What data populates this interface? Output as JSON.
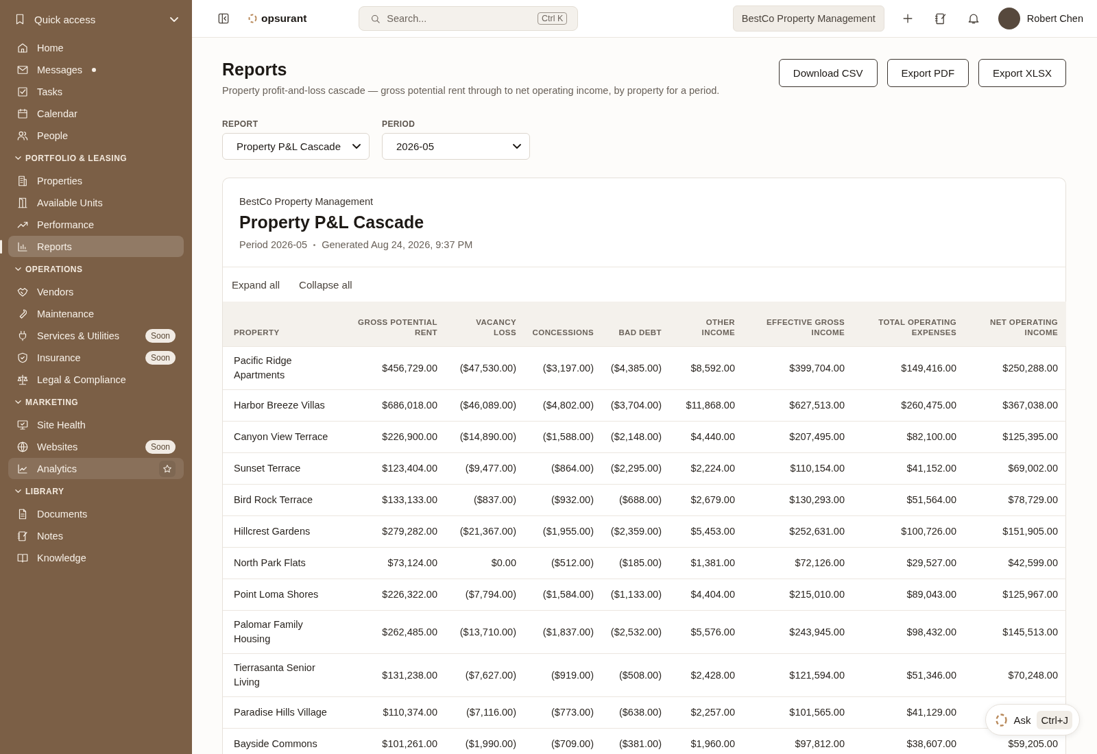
{
  "sidebar": {
    "sections": [
      {
        "kind": "quick",
        "title": "Quick access",
        "expanded": true,
        "items": [
          {
            "label": "Home",
            "selected": false,
            "hovered": false,
            "unread": false
          },
          {
            "label": "Messages",
            "selected": false,
            "hovered": false,
            "unread": true
          },
          {
            "label": "Tasks",
            "selected": false,
            "hovered": false,
            "unread": false
          },
          {
            "label": "Calendar",
            "selected": false,
            "hovered": false,
            "unread": false
          },
          {
            "label": "People",
            "selected": false,
            "hovered": false,
            "unread": false
          }
        ]
      },
      {
        "kind": "group",
        "title": "PORTFOLIO & LEASING",
        "expanded": true,
        "items": [
          {
            "label": "Properties",
            "selected": false,
            "hovered": false,
            "unread": false
          },
          {
            "label": "Available Units",
            "selected": false,
            "hovered": false,
            "unread": false
          },
          {
            "label": "Performance",
            "selected": false,
            "hovered": false,
            "unread": false
          },
          {
            "label": "Reports",
            "selected": true,
            "hovered": false,
            "unread": false
          }
        ]
      },
      {
        "kind": "group",
        "title": "OPERATIONS",
        "expanded": true,
        "items": [
          {
            "label": "Vendors",
            "selected": false,
            "hovered": false,
            "unread": false
          },
          {
            "label": "Maintenance",
            "selected": false,
            "hovered": false,
            "unread": false
          },
          {
            "label": "Services & Utilities",
            "badge": "Soon",
            "selected": false,
            "hovered": false,
            "unread": false
          },
          {
            "label": "Insurance",
            "badge": "Soon",
            "selected": false,
            "hovered": false,
            "unread": false
          },
          {
            "label": "Legal & Compliance",
            "selected": false,
            "hovered": false,
            "unread": false
          }
        ]
      },
      {
        "kind": "group",
        "title": "MARKETING",
        "expanded": true,
        "items": [
          {
            "label": "Site Health",
            "selected": false,
            "hovered": false,
            "unread": false
          },
          {
            "label": "Websites",
            "badge": "Soon",
            "selected": false,
            "hovered": false,
            "unread": false
          },
          {
            "label": "Analytics",
            "selected": false,
            "hovered": true,
            "unread": false
          }
        ]
      },
      {
        "kind": "group",
        "title": "LIBRARY",
        "expanded": true,
        "items": [
          {
            "label": "Documents",
            "selected": false,
            "hovered": false,
            "unread": false
          },
          {
            "label": "Notes",
            "selected": false,
            "hovered": false,
            "unread": false
          },
          {
            "label": "Knowledge",
            "selected": false,
            "hovered": false,
            "unread": false
          }
        ]
      }
    ]
  },
  "topbar": {
    "logo": "opsurant",
    "search": {
      "placeholder": "Search...",
      "shortcut": "Ctrl K"
    },
    "organization": "BestCo Property Management",
    "user": "Robert Chen"
  },
  "page": {
    "title": "Reports",
    "description": "Property profit-and-loss cascade — gross potential rent through to net operating income, by property for a period.",
    "actions": [
      "Download CSV",
      "Export PDF",
      "Export XLSX"
    ],
    "filters": [
      {
        "label": "REPORT",
        "value": "Property P&L Cascade"
      },
      {
        "label": "PERIOD",
        "value": "2026-05"
      }
    ]
  },
  "report": {
    "organization": "BestCo Property Management",
    "title": "Property P&L Cascade",
    "meta": [
      "Period 2026-05",
      "Generated Aug 24, 2026, 9:37 PM"
    ],
    "controls": [
      "Expand all",
      "Collapse all"
    ],
    "table": {
      "columns": [
        "PROPERTY",
        "GROSS POTENTIAL RENT",
        "VACANCY LOSS",
        "CONCESSIONS",
        "BAD DEBT",
        "OTHER INCOME",
        "EFFECTIVE GROSS INCOME",
        "TOTAL OPERATING EXPENSES",
        "NET OPERATING INCOME"
      ],
      "rows": [
        [
          "Pacific Ridge Apartments",
          "$456,729.00",
          "($47,530.00)",
          "($3,197.00)",
          "($4,385.00)",
          "$8,592.00",
          "$399,704.00",
          "$149,416.00",
          "$250,288.00"
        ],
        [
          "Harbor Breeze Villas",
          "$686,018.00",
          "($46,089.00)",
          "($4,802.00)",
          "($3,704.00)",
          "$11,868.00",
          "$627,513.00",
          "$260,475.00",
          "$367,038.00"
        ],
        [
          "Canyon View Terrace",
          "$226,900.00",
          "($14,890.00)",
          "($1,588.00)",
          "($2,148.00)",
          "$4,440.00",
          "$207,495.00",
          "$82,100.00",
          "$125,395.00"
        ],
        [
          "Sunset Terrace",
          "$123,404.00",
          "($9,477.00)",
          "($864.00)",
          "($2,295.00)",
          "$2,224.00",
          "$110,154.00",
          "$41,152.00",
          "$69,002.00"
        ],
        [
          "Bird Rock Terrace",
          "$133,133.00",
          "($837.00)",
          "($932.00)",
          "($688.00)",
          "$2,679.00",
          "$130,293.00",
          "$51,564.00",
          "$78,729.00"
        ],
        [
          "Hillcrest Gardens",
          "$279,282.00",
          "($21,367.00)",
          "($1,955.00)",
          "($2,359.00)",
          "$5,453.00",
          "$252,631.00",
          "$100,726.00",
          "$151,905.00"
        ],
        [
          "North Park Flats",
          "$73,124.00",
          "$0.00",
          "($512.00)",
          "($185.00)",
          "$1,381.00",
          "$72,126.00",
          "$29,527.00",
          "$42,599.00"
        ],
        [
          "Point Loma Shores",
          "$226,322.00",
          "($7,794.00)",
          "($1,584.00)",
          "($1,133.00)",
          "$4,404.00",
          "$215,010.00",
          "$89,043.00",
          "$125,967.00"
        ],
        [
          "Palomar Family Housing",
          "$262,485.00",
          "($13,710.00)",
          "($1,837.00)",
          "($2,532.00)",
          "$5,576.00",
          "$243,945.00",
          "$98,432.00",
          "$145,513.00"
        ],
        [
          "Tierrasanta Senior Living",
          "$131,238.00",
          "($7,627.00)",
          "($919.00)",
          "($508.00)",
          "$2,428.00",
          "$121,594.00",
          "$51,346.00",
          "$70,248.00"
        ],
        [
          "Paradise Hills Village",
          "$110,374.00",
          "($7,116.00)",
          "($773.00)",
          "($638.00)",
          "$2,257.00",
          "$101,565.00",
          "$41,129.00",
          null
        ],
        [
          "Bayside Commons",
          "$101,261.00",
          "($1,990.00)",
          "($709.00)",
          "($381.00)",
          "$1,960.00",
          "$97,812.00",
          "$38,607.00",
          "$59,205.00"
        ]
      ]
    }
  },
  "assistant": {
    "label": "Ask",
    "shortcut": "Ctrl+J"
  }
}
